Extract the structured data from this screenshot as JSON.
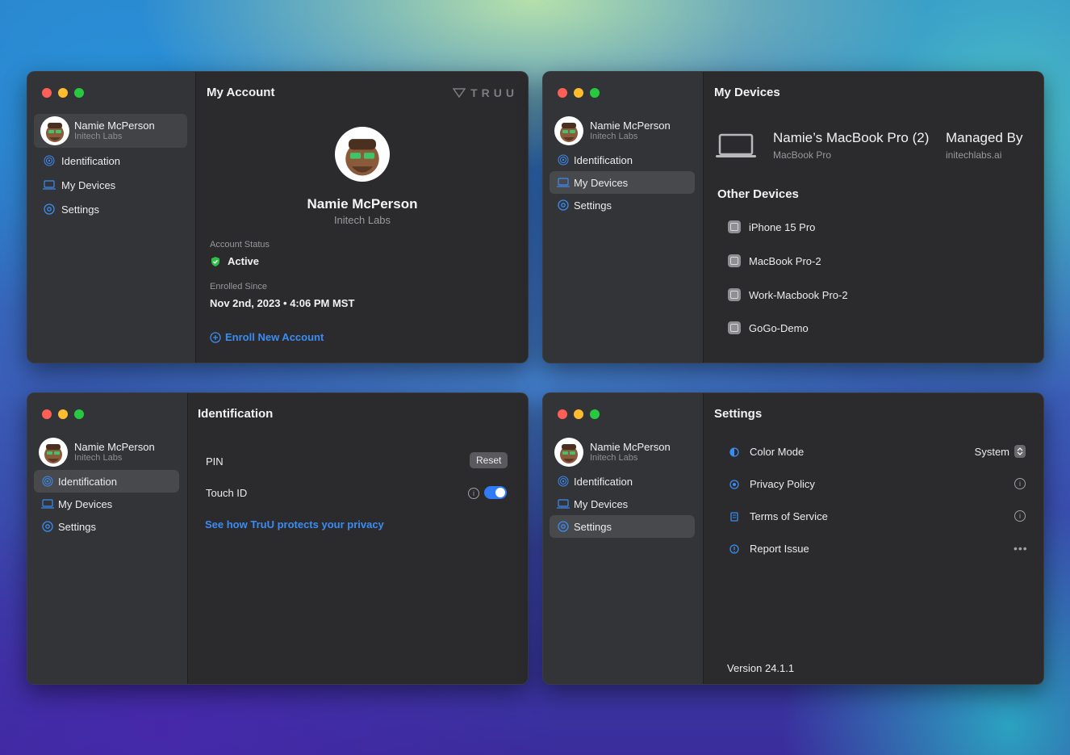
{
  "common": {
    "user_name": "Namie McPerson",
    "org": "Initech Labs",
    "nav": {
      "identification": "Identification",
      "devices": "My Devices",
      "settings": "Settings"
    }
  },
  "colors": {
    "accent": "#3b8cf2",
    "active_green": "#30c048",
    "selected_row": "#48494d"
  },
  "account": {
    "title": "My Account",
    "brand": "TRUU",
    "name": "Namie McPerson",
    "org": "Initech Labs",
    "status_label": "Account Status",
    "status_value": "Active",
    "enrolled_label": "Enrolled Since",
    "enrolled_value": "Nov 2nd, 2023 • 4:06 PM MST",
    "enroll_link": "Enroll New Account"
  },
  "devices": {
    "title": "My Devices",
    "current_device_name": "Namie’s MacBook Pro (2)",
    "current_device_model": "MacBook Pro",
    "managed_by_label": "Managed By",
    "managed_by_value": "initechlabs.ai",
    "other_title": "Other Devices",
    "other": [
      "iPhone 15 Pro",
      "MacBook Pro-2",
      "Work-Macbook Pro-2",
      "GoGo-Demo"
    ]
  },
  "identification": {
    "title": "Identification",
    "pin_label": "PIN",
    "reset_label": "Reset",
    "touchid_label": "Touch ID",
    "touchid_enabled": true,
    "privacy_link": "See how TruU protects your privacy"
  },
  "settings": {
    "title": "Settings",
    "color_mode_label": "Color Mode",
    "color_mode_value": "System",
    "privacy_label": "Privacy Policy",
    "terms_label": "Terms of Service",
    "report_label": "Report Issue",
    "version": "Version 24.1.1"
  },
  "icons": [
    "fingerprint-icon",
    "laptop-icon",
    "gear-icon",
    "shield-check-icon",
    "plus-circle-icon",
    "device-icon",
    "info-icon",
    "more-icon",
    "chevron-updown-icon"
  ]
}
